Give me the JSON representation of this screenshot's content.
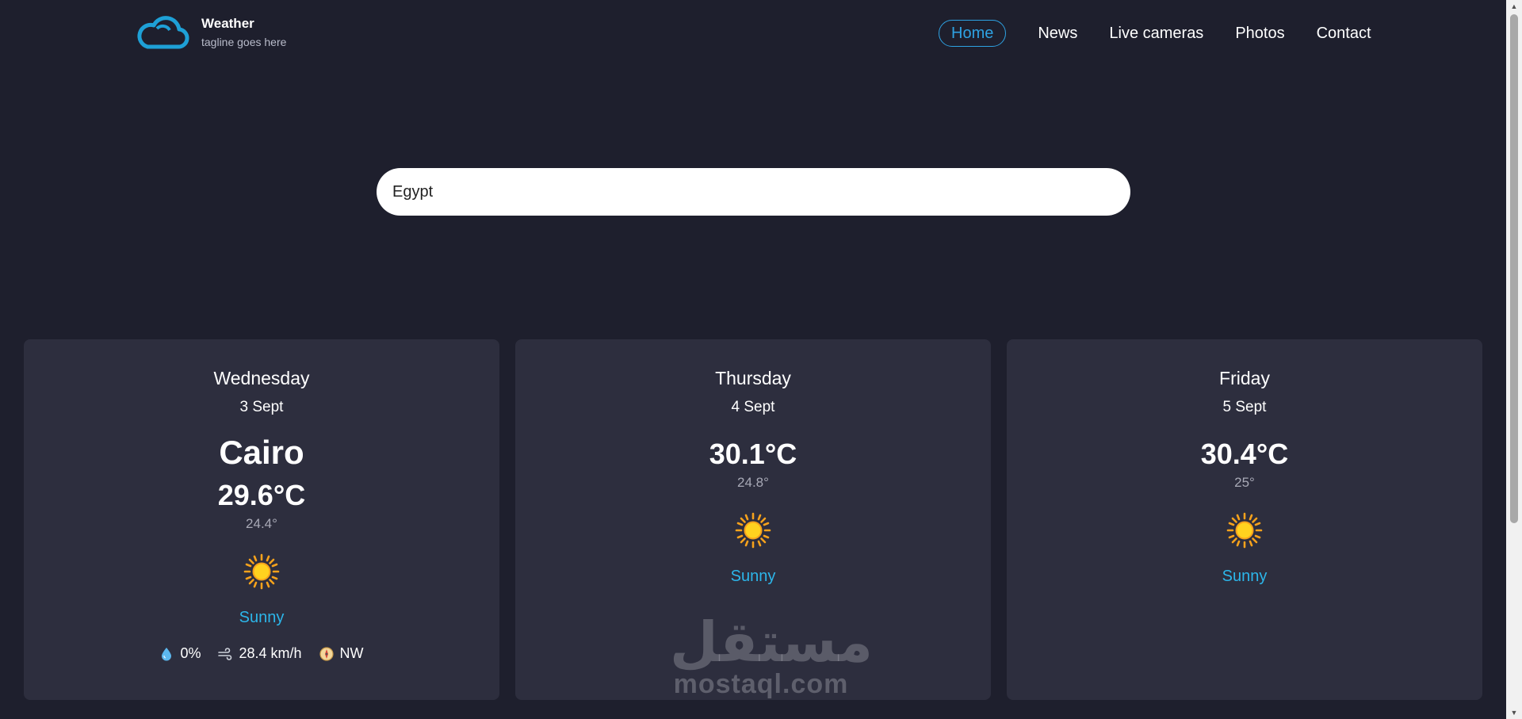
{
  "header": {
    "brand_title": "Weather",
    "brand_tagline": "tagline goes here",
    "nav": [
      "Home",
      "News",
      "Live cameras",
      "Photos",
      "Contact"
    ],
    "active_nav": "Home"
  },
  "search": {
    "value": "Egypt"
  },
  "today": {
    "day": "Wednesday",
    "date": "3 Sept",
    "city": "Cairo",
    "temp": "29.6°C",
    "min": "24.4°",
    "condition": "Sunny",
    "icon": "sun-icon",
    "rain": "0%",
    "wind": "28.4 km/h",
    "direction": "NW"
  },
  "forecast": [
    {
      "day": "Thursday",
      "date": "4 Sept",
      "temp": "30.1°C",
      "min": "24.8°",
      "condition": "Sunny",
      "icon": "sun-icon"
    },
    {
      "day": "Friday",
      "date": "5 Sept",
      "temp": "30.4°C",
      "min": "25°",
      "condition": "Sunny",
      "icon": "sun-icon"
    }
  ],
  "watermark": {
    "arabic": "مستقل",
    "latin": "mostaql.com"
  },
  "colors": {
    "background": "#1e1f2d",
    "card": "#2d2e3e",
    "accent": "#2ea2e3",
    "condition": "#2cb6ea",
    "sun": "#ffd21f"
  }
}
